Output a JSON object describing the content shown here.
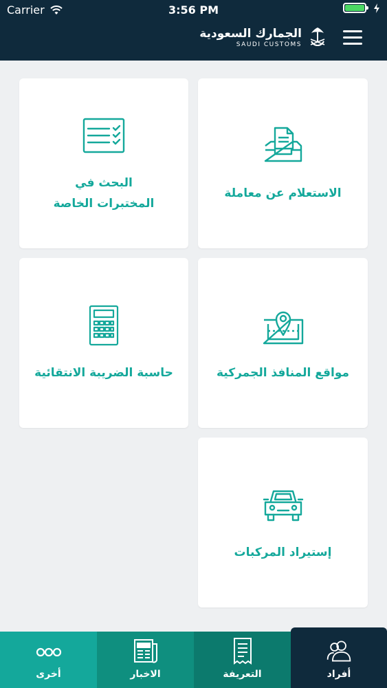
{
  "status_bar": {
    "carrier": "Carrier",
    "time": "3:56 PM"
  },
  "header": {
    "logo_ar": "الجمارك السعودية",
    "logo_en": "SAUDI CUSTOMS"
  },
  "cards": [
    {
      "label": "الاستعلام عن معاملة",
      "icon": "document-inbox-icon"
    },
    {
      "label": "البحث في\nالمختبرات الخاصة",
      "icon": "checklist-icon"
    },
    {
      "label": "مواقع المنافذ الجمركية",
      "icon": "map-pin-icon"
    },
    {
      "label": "حاسبة الضريبة الانتقائية",
      "icon": "calculator-icon"
    },
    {
      "label": "إستيراد المركبات",
      "icon": "car-icon"
    }
  ],
  "tabs": [
    {
      "label": "أفراد",
      "icon": "users-icon",
      "active": true
    },
    {
      "label": "التعريفة",
      "icon": "receipt-icon",
      "active": false
    },
    {
      "label": "الاخبار",
      "icon": "newspaper-icon",
      "active": false
    },
    {
      "label": "أخرى",
      "icon": "more-dots-icon",
      "active": false
    }
  ],
  "colors": {
    "header_bg": "#0f2a3c",
    "accent": "#14a89b",
    "page_bg": "#eef0f2",
    "battery": "#4cd964"
  },
  "battery_level": 1.0
}
